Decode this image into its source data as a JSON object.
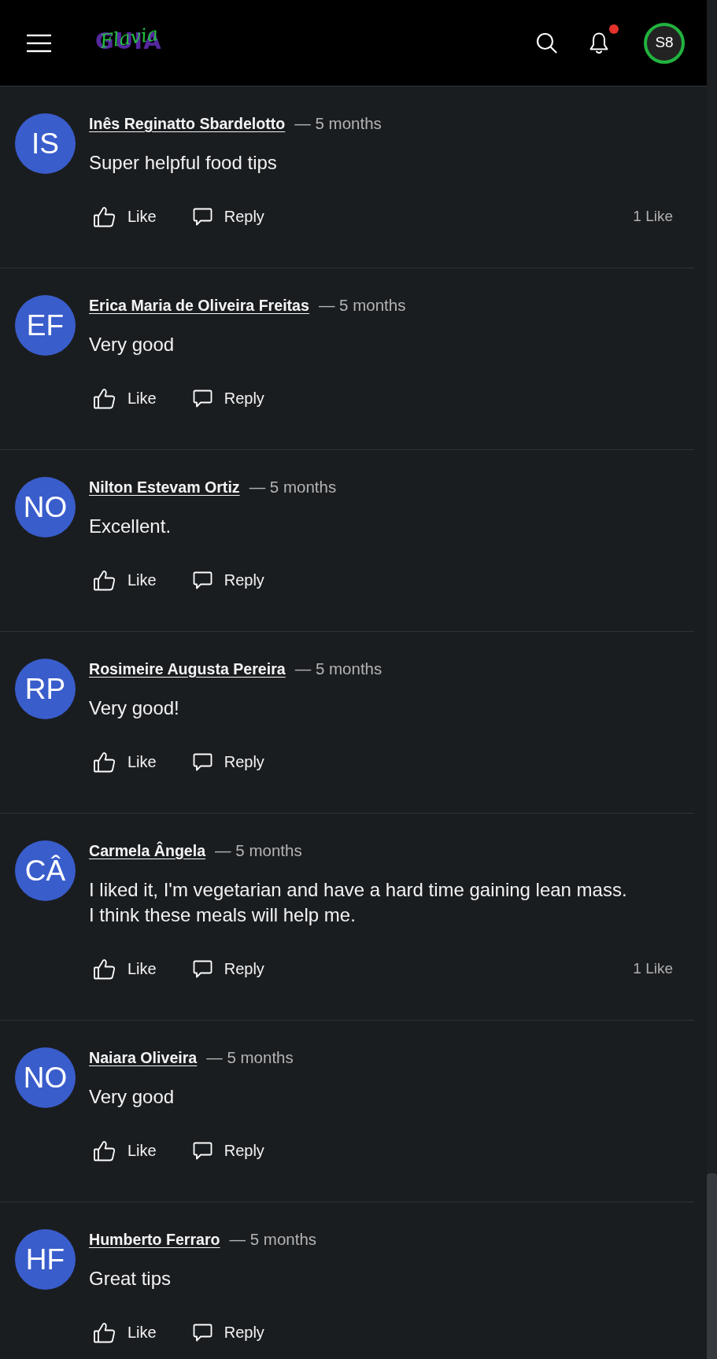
{
  "header": {
    "logo": {
      "wordmark": "GUIA",
      "script": "Flavia"
    },
    "notifications": {
      "unread": true
    },
    "profile": {
      "initials": "S8"
    }
  },
  "comments": [
    {
      "initials": "IS",
      "author": "Inês Reginatto Sbardelotto",
      "age": "— 5 months",
      "text": "Super helpful food tips",
      "like_label": "Like",
      "reply_label": "Reply",
      "like_count": "1 Like"
    },
    {
      "initials": "EF",
      "author": "Erica Maria de Oliveira Freitas",
      "age": "— 5 months",
      "text": "Very good",
      "like_label": "Like",
      "reply_label": "Reply"
    },
    {
      "initials": "NO",
      "author": "Nilton Estevam Ortiz",
      "age": "— 5 months",
      "text": "Excellent.",
      "like_label": "Like",
      "reply_label": "Reply"
    },
    {
      "initials": "RP",
      "author": "Rosimeire Augusta Pereira",
      "age": "— 5 months",
      "text": "Very good!",
      "like_label": "Like",
      "reply_label": "Reply"
    },
    {
      "initials": "CÂ",
      "author": "Carmela Ângela",
      "age": "— 5 months",
      "text": "I liked it, I'm vegetarian and have a hard time gaining lean mass.\nI think these meals will help me.",
      "like_label": "Like",
      "reply_label": "Reply",
      "like_count": "1 Like"
    },
    {
      "initials": "NO",
      "author": "Naiara Oliveira",
      "age": "— 5 months",
      "text": "Very good",
      "like_label": "Like",
      "reply_label": "Reply"
    },
    {
      "initials": "HF",
      "author": "Humberto Ferraro",
      "age": "— 5 months",
      "text": "Great tips",
      "like_label": "Like",
      "reply_label": "Reply"
    }
  ]
}
